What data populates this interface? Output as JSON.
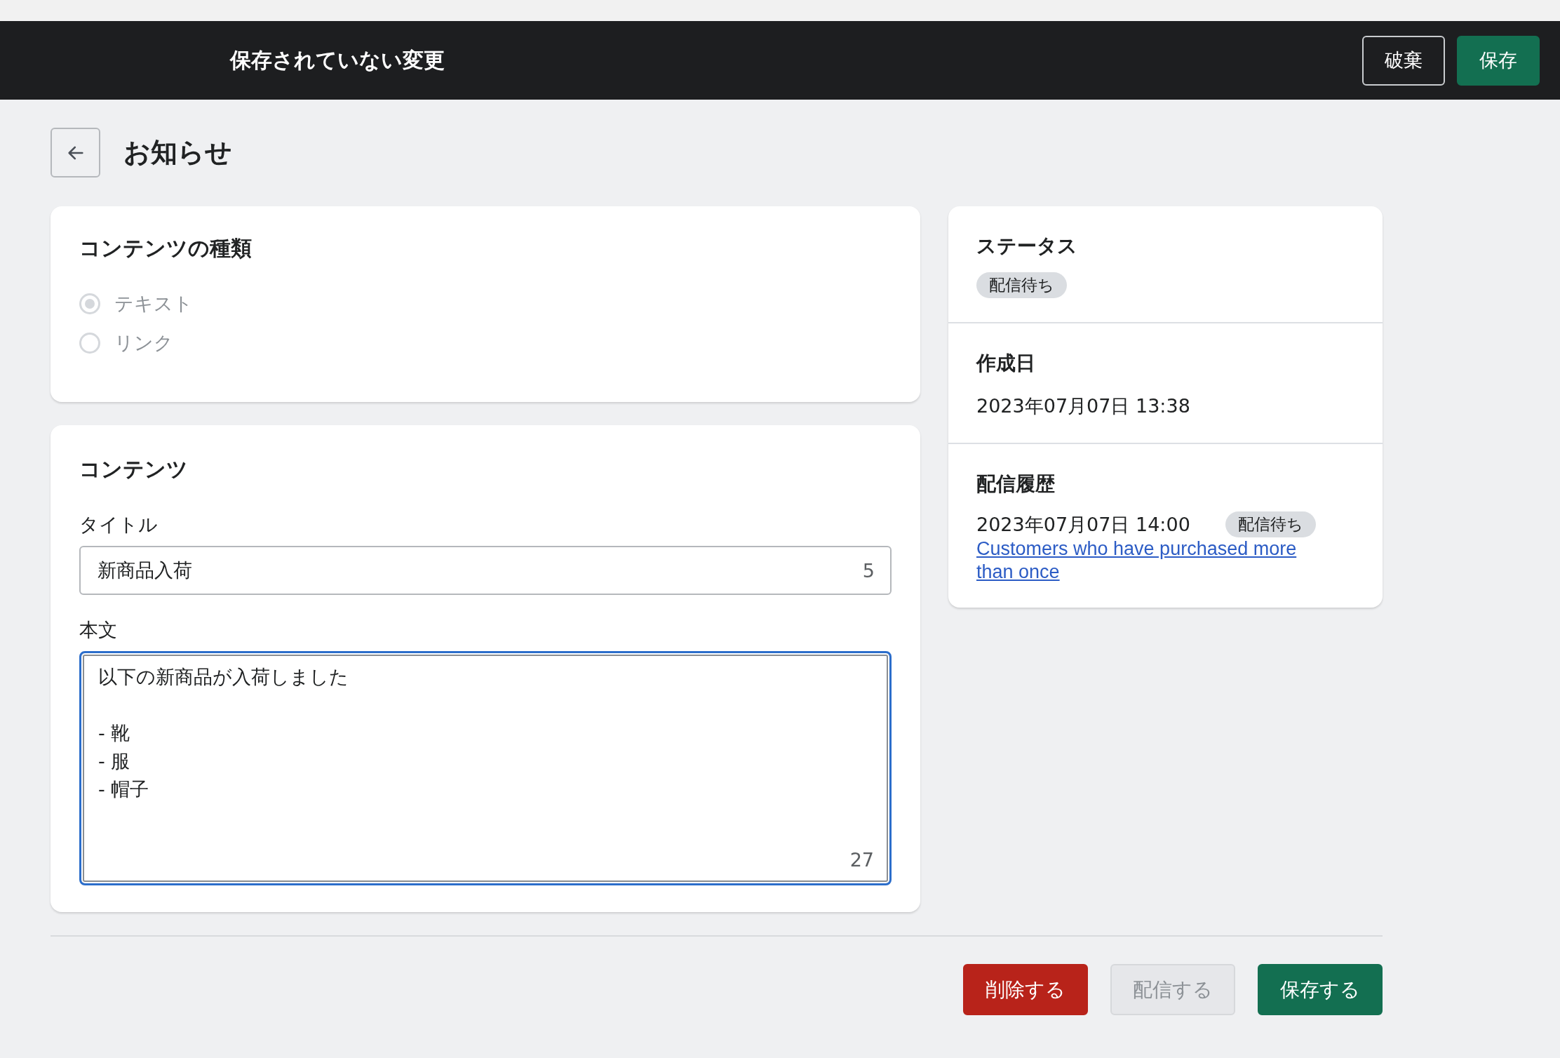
{
  "unsaved_bar": {
    "title": "保存されていない変更",
    "buttons": [
      {
        "label": "破棄",
        "kind": "outline"
      },
      {
        "label": "保存",
        "kind": "primary"
      }
    ]
  },
  "page": {
    "title": "お知らせ"
  },
  "content_type_card": {
    "title": "コンテンツの種類",
    "options": [
      {
        "label": "テキスト",
        "selected": true,
        "disabled": true
      },
      {
        "label": "リンク",
        "selected": false,
        "disabled": true
      }
    ]
  },
  "content_card": {
    "title": "コンテンツ",
    "title_field": {
      "label": "タイトル",
      "value": "新商品入荷",
      "count": "5"
    },
    "body_field": {
      "label": "本文",
      "value": "以下の新商品が入荷しました\n\n- 靴\n- 服\n- 帽子",
      "count": "27",
      "focused": true
    }
  },
  "side_card": {
    "status": {
      "title": "ステータス",
      "badge": "配信待ち"
    },
    "created": {
      "title": "作成日",
      "value": "2023年07月07日 13:38"
    },
    "history": {
      "title": "配信履歴",
      "entries": [
        {
          "datetime": "2023年07月07日 14:00",
          "badge": "配信待ち",
          "segment_link": "Customers who have purchased more than once"
        }
      ]
    }
  },
  "footer_buttons": [
    {
      "label": "削除する",
      "kind": "danger"
    },
    {
      "label": "配信する",
      "kind": "disabled"
    },
    {
      "label": "保存する",
      "kind": "primary"
    }
  ]
}
